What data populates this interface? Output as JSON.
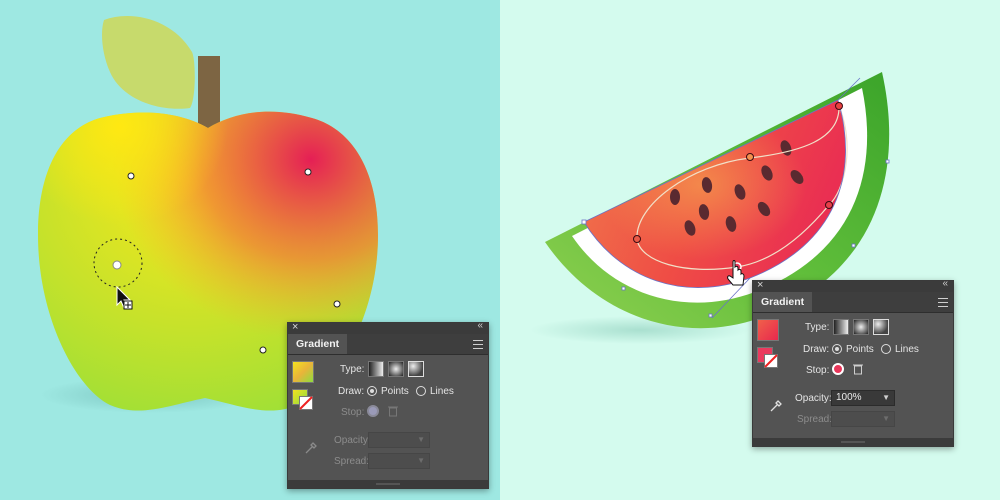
{
  "colors": {
    "left_background": "#9ee8e2",
    "right_background": "#d4fbee",
    "panel_bg": "#535353",
    "apple_gradient": [
      "#f6ea1a",
      "#e8264f",
      "#8fe03c"
    ],
    "watermelon_flesh": [
      "#f38a52",
      "#ef4a4a",
      "#ee3a6a"
    ],
    "rind_green": "#49b02a"
  },
  "left_panel": {
    "title": "Gradient",
    "close_icon": "close-icon",
    "collapse_icon": "double-chevron-icon",
    "menu_icon": "panel-menu-icon",
    "type_label": "Type:",
    "type_options": [
      "linear-gradient-icon",
      "radial-gradient-icon",
      "freeform-gradient-icon"
    ],
    "draw_label": "Draw:",
    "draw_points": "Points",
    "draw_lines": "Lines",
    "stop_label": "Stop:",
    "opacity_label": "Opacity:",
    "opacity_value": "",
    "spread_label": "Spread:",
    "spread_value": ""
  },
  "right_panel": {
    "title": "Gradient",
    "close_icon": "close-icon",
    "collapse_icon": "double-chevron-icon",
    "menu_icon": "panel-menu-icon",
    "type_label": "Type:",
    "type_options": [
      "linear-gradient-icon",
      "radial-gradient-icon",
      "freeform-gradient-icon"
    ],
    "draw_label": "Draw:",
    "draw_points": "Points",
    "draw_lines": "Lines",
    "stop_label": "Stop:",
    "opacity_label": "Opacity:",
    "opacity_value": "100%",
    "spread_label": "Spread:",
    "spread_value": ""
  }
}
